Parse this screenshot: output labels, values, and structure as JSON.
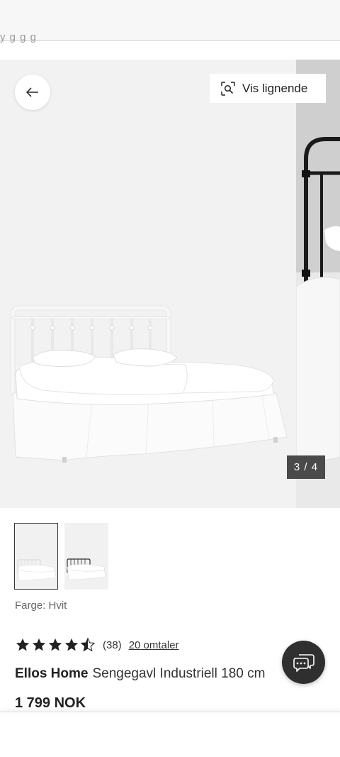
{
  "header": {
    "cut_text": "  y                   g               g g"
  },
  "gallery": {
    "back_icon": "arrow-left-icon",
    "similar_icon": "visual-search-icon",
    "similar_label": "Vis lignende",
    "counter": "3 / 4"
  },
  "thumbnails": [
    {
      "name": "white-bed-thumbnail",
      "active": true
    },
    {
      "name": "black-bed-thumbnail",
      "active": false
    }
  ],
  "product": {
    "color_label": "Farge: Hvit",
    "rating": {
      "value": 4.5,
      "max": 5,
      "count_text": "(38)",
      "reviews_link": "20 omtaler"
    },
    "brand": "Ellos Home",
    "name": "Sengegavl Industriell 180 cm",
    "price": "1 799 NOK"
  },
  "chat": {
    "icon": "chat-bubbles-icon"
  },
  "colors": {
    "star": "#222222",
    "counter_bg": "#4a4a4a",
    "chat_bg": "#2f2f2f"
  }
}
